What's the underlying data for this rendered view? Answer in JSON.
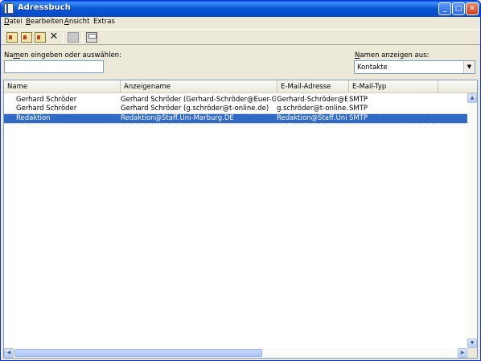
{
  "window": {
    "title": "Adressbuch",
    "minimize_glyph": "_",
    "maximize_glyph": "□",
    "close_glyph": "✕"
  },
  "menu": {
    "items": [
      {
        "first": "D",
        "rest": "atei"
      },
      {
        "first": "B",
        "rest": "earbeiten"
      },
      {
        "first": "A",
        "rest": "nsicht"
      },
      {
        "first": "E",
        "rest": "xtras",
        "pre": "",
        "ul_index": 1
      }
    ]
  },
  "toolbar": {
    "icons": [
      "new-contact-icon",
      "new-group-icon",
      "properties-icon",
      "delete-icon",
      "find-people-icon",
      "print-icon"
    ],
    "delete_glyph": "✕"
  },
  "search": {
    "label_pre": "Na",
    "label_ul": "m",
    "label_post": "en eingeben oder auswählen:",
    "value": ""
  },
  "source": {
    "label_pre": "",
    "label_ul": "N",
    "label_post": "amen anzeigen aus:",
    "selected": "Kontakte",
    "arrow": "▼"
  },
  "list": {
    "columns": [
      "Name",
      "Anzeigename",
      "E-Mail-Adresse",
      "E-Mail-Typ"
    ],
    "rows": [
      {
        "name": "Gerhard Schröder",
        "display": "Gerhard Schröder (Gerhard-Schröder@Euer-Gerd.de)",
        "email": "Gerhard-Schröder@E...",
        "type": "SMTP",
        "selected": false
      },
      {
        "name": "Gerhard Schröder",
        "display": "Gerhard Schröder (g.schröder@t-online.de)",
        "email": "g.schröder@t-online.de",
        "type": "SMTP",
        "selected": false
      },
      {
        "name": "Redaktion",
        "display": "Redaktion@Staff.Uni-Marburg.DE",
        "email": "Redaktion@Staff.Uni-...",
        "type": "SMTP",
        "selected": true
      }
    ]
  },
  "scroll": {
    "up": "▲",
    "down": "▼",
    "left": "◀",
    "right": "▶"
  },
  "colors": {
    "titlebar": "#0a5fde",
    "selection": "#316ac5"
  }
}
